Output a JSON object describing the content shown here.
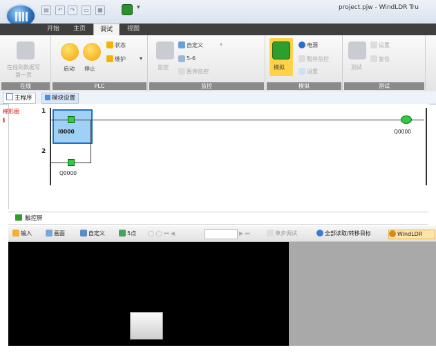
{
  "window": {
    "title": "project.pjw - WindLDR Tru",
    "quick_access": [
      "▤",
      "↶",
      "↷",
      "▭",
      "▦"
    ],
    "more": "▾"
  },
  "tabs": [
    {
      "label": "开始",
      "active": false
    },
    {
      "label": "主页",
      "active": false
    },
    {
      "label": "调试",
      "active": true
    },
    {
      "label": "视图",
      "active": false
    }
  ],
  "ribbon": {
    "groups": [
      {
        "name": "在线",
        "items": [
          {
            "label": "在线到数据写",
            "sub": "第一页"
          }
        ]
      },
      {
        "name": "PLC",
        "items": [
          {
            "label": "启动",
            "icon": "run-icon"
          },
          {
            "label": "停止",
            "icon": "stop-icon"
          },
          {
            "label": "状态",
            "icon": "status-icon"
          },
          {
            "label": "维护",
            "icon": "maintenance-icon"
          }
        ]
      },
      {
        "name": "监控",
        "items": [
          {
            "label": "监控"
          },
          {
            "label": "自定义"
          },
          {
            "label": "5-6"
          },
          {
            "label": "暂停监控"
          }
        ]
      },
      {
        "name": "模拟",
        "items": [
          {
            "label": "模拟"
          },
          {
            "label": "电源"
          },
          {
            "label": "暂停监控"
          },
          {
            "label": "设置"
          }
        ]
      },
      {
        "name": "测试",
        "items": [
          {
            "label": "测试"
          },
          {
            "label": "设置"
          },
          {
            "label": "复位"
          }
        ]
      }
    ],
    "accent": "#f5b400"
  },
  "doc_tabs": [
    {
      "label": "主程序",
      "active": false
    },
    {
      "label": "模块设置",
      "active": true
    }
  ],
  "ladder": {
    "comment": "梯形图",
    "marker": "I",
    "rungs": [
      {
        "number": "1",
        "contact": "I0000",
        "coil": "Q0000"
      },
      {
        "number": "2",
        "contact": "Q0000"
      }
    ]
  },
  "monitor": {
    "title": "触控屏",
    "toolbar": [
      {
        "label": "输入",
        "icon": "input-icon"
      },
      {
        "label": "画面",
        "icon": "screen-icon"
      },
      {
        "label": "自定义",
        "icon": "custom-icon"
      },
      {
        "label": "5点",
        "icon": "points-icon"
      },
      {
        "label": "单步调试",
        "icon": "step-icon"
      },
      {
        "label": "全部读取/转移目标",
        "icon": "read-all-icon"
      },
      {
        "label": "WindLDR",
        "icon": "windldr-icon"
      }
    ]
  }
}
